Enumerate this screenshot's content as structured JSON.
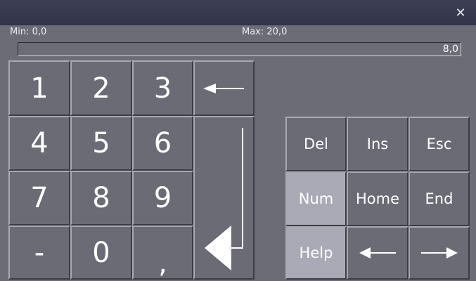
{
  "window": {
    "close_icon": "close-icon"
  },
  "range": {
    "min_label": "Min: 0,0",
    "max_label": "Max: 20,0"
  },
  "input": {
    "value": "8,0"
  },
  "numpad": {
    "k1": "1",
    "k2": "2",
    "k3": "3",
    "k4": "4",
    "k5": "5",
    "k6": "6",
    "k7": "7",
    "k8": "8",
    "k9": "9",
    "minus": "-",
    "k0": "0",
    "comma": ","
  },
  "function_keys": {
    "del": "Del",
    "ins": "Ins",
    "esc": "Esc",
    "num": "Num",
    "home": "Home",
    "end": "End",
    "help": "Help"
  },
  "icons": {
    "backspace": "backspace-arrow-icon",
    "enter": "enter-icon",
    "left": "arrow-left-icon",
    "right": "arrow-right-icon"
  },
  "colors": {
    "background": "#6b6c76",
    "titlebar": "#32344a",
    "active_key": "#a9aab6",
    "text": "#ffffff"
  }
}
